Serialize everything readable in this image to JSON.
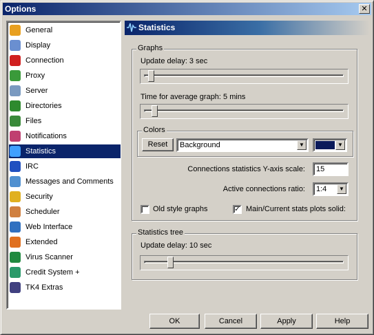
{
  "window": {
    "title": "Options",
    "close_glyph": "✕"
  },
  "nav": {
    "items": [
      {
        "label": "General",
        "icon": "gear-icon",
        "color": "#e8a020"
      },
      {
        "label": "Display",
        "icon": "monitor-icon",
        "color": "#6a8fd0"
      },
      {
        "label": "Connection",
        "icon": "plug-icon",
        "color": "#d02020"
      },
      {
        "label": "Proxy",
        "icon": "proxy-icon",
        "color": "#3a9a3a"
      },
      {
        "label": "Server",
        "icon": "server-icon",
        "color": "#7a9ac0"
      },
      {
        "label": "Directories",
        "icon": "folder-tree-icon",
        "color": "#2e8a2e"
      },
      {
        "label": "Files",
        "icon": "files-icon",
        "color": "#3a8a3a"
      },
      {
        "label": "Notifications",
        "icon": "notification-icon",
        "color": "#c04070"
      },
      {
        "label": "Statistics",
        "icon": "statistics-icon",
        "color": "#40a0ff"
      },
      {
        "label": "IRC",
        "icon": "irc-icon",
        "color": "#2050c0"
      },
      {
        "label": "Messages and Comments",
        "icon": "messages-icon",
        "color": "#5090d0"
      },
      {
        "label": "Security",
        "icon": "lock-icon",
        "color": "#e0b020"
      },
      {
        "label": "Scheduler",
        "icon": "calendar-icon",
        "color": "#d08040"
      },
      {
        "label": "Web Interface",
        "icon": "globe-icon",
        "color": "#3070c0"
      },
      {
        "label": "Extended",
        "icon": "puzzle-icon",
        "color": "#e07020"
      },
      {
        "label": "Virus Scanner",
        "icon": "virus-scanner-icon",
        "color": "#208a40"
      },
      {
        "label": "Credit System +",
        "icon": "credit-icon",
        "color": "#2a9a6a"
      },
      {
        "label": "TK4 Extras",
        "icon": "extras-icon",
        "color": "#404080"
      }
    ],
    "selected_index": 8
  },
  "panel": {
    "title": "Statistics",
    "graphs": {
      "legend": "Graphs",
      "update_delay_label": "Update delay: 3 sec",
      "update_delay_fraction": 0.02,
      "avg_graph_label": "Time for average graph: 5 mins",
      "avg_graph_fraction": 0.04,
      "colors": {
        "legend": "Colors",
        "reset_label": "Reset",
        "selected": "Background",
        "swatch_color": "#0a1a5a"
      },
      "yaxis_label": "Connections statistics Y-axis scale:",
      "yaxis_value": "15",
      "ratio_label": "Active connections ratio:",
      "ratio_value": "1:4",
      "old_style_label": "Old style graphs",
      "old_style_checked": false,
      "solid_label": "Main/Current stats plots solid:",
      "solid_checked": true
    },
    "stats_tree": {
      "legend": "Statistics tree",
      "update_delay_label": "Update delay: 10 sec",
      "update_delay_fraction": 0.12
    }
  },
  "footer": {
    "ok": "OK",
    "cancel": "Cancel",
    "apply": "Apply",
    "help": "Help"
  }
}
